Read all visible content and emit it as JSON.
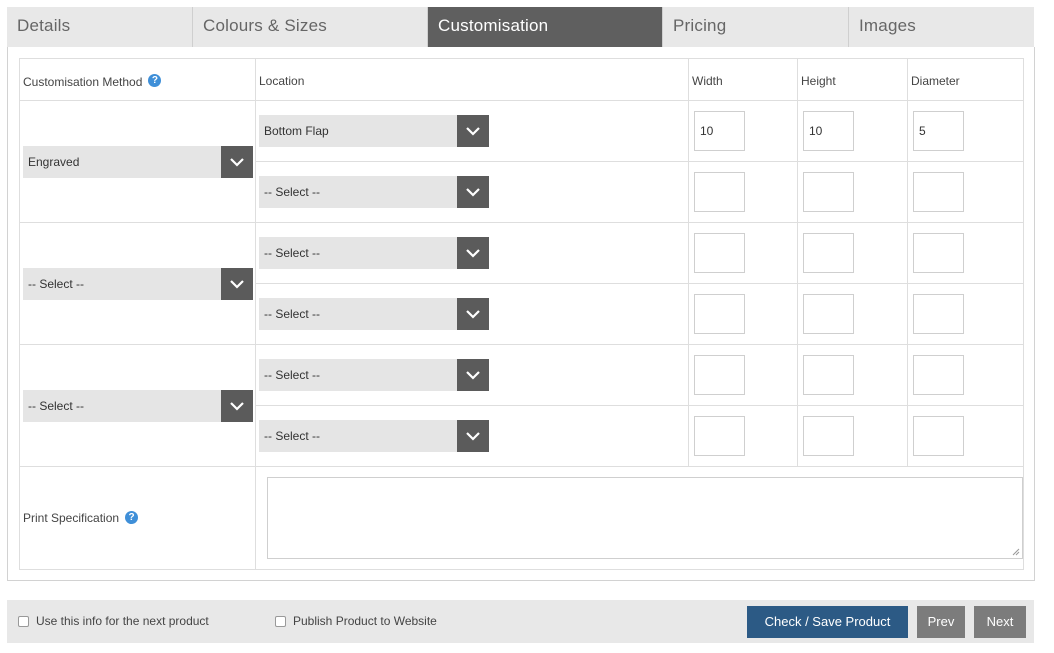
{
  "tabs": [
    {
      "label": "Details"
    },
    {
      "label": "Colours & Sizes"
    },
    {
      "label": "Customisation"
    },
    {
      "label": "Pricing"
    },
    {
      "label": "Images"
    }
  ],
  "table": {
    "headers": {
      "method": "Customisation Method",
      "location": "Location",
      "width": "Width",
      "height": "Height",
      "diameter": "Diameter"
    },
    "groups": [
      {
        "method": "Engraved",
        "rows": [
          {
            "location": "Bottom Flap",
            "width": "10",
            "height": "10",
            "diameter": "5"
          },
          {
            "location": "-- Select --",
            "width": "",
            "height": "",
            "diameter": ""
          }
        ]
      },
      {
        "method": "-- Select --",
        "rows": [
          {
            "location": "-- Select --",
            "width": "",
            "height": "",
            "diameter": ""
          },
          {
            "location": "-- Select --",
            "width": "",
            "height": "",
            "diameter": ""
          }
        ]
      },
      {
        "method": "-- Select --",
        "rows": [
          {
            "location": "-- Select --",
            "width": "",
            "height": "",
            "diameter": ""
          },
          {
            "location": "-- Select --",
            "width": "",
            "height": "",
            "diameter": ""
          }
        ]
      }
    ],
    "print_spec_label": "Print Specification",
    "print_spec_value": ""
  },
  "footer": {
    "use_info_label": "Use this info for the next product",
    "publish_label": "Publish Product to Website",
    "save_label": "Check / Save Product",
    "prev_label": "Prev",
    "next_label": "Next"
  },
  "icons": {
    "help": "help-icon",
    "dropdown": "chevron-down-icon"
  },
  "colors": {
    "active_tab": "#5f5f5f",
    "primary_button": "#2c5a85",
    "help_icon": "#3f8fd8"
  }
}
